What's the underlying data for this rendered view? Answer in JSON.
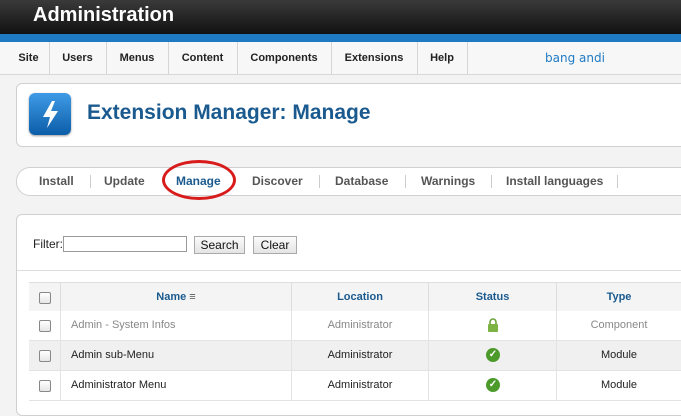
{
  "app": {
    "title": "Administration"
  },
  "menu": {
    "items": [
      "Site",
      "Users",
      "Menus",
      "Content",
      "Components",
      "Extensions",
      "Help"
    ],
    "user": "bang andi"
  },
  "header": {
    "title": "Extension Manager: Manage",
    "icon": "lightning-icon"
  },
  "subnav": {
    "items": [
      "Install",
      "Update",
      "Manage",
      "Discover",
      "Database",
      "Warnings",
      "Install languages"
    ],
    "active": "Manage"
  },
  "filter": {
    "label": "Filter:",
    "value": "",
    "search_label": "Search",
    "clear_label": "Clear"
  },
  "table": {
    "columns": [
      "Name",
      "Location",
      "Status",
      "Type"
    ],
    "rows": [
      {
        "name": "Admin - System Infos",
        "location": "Administrator",
        "status": "protected",
        "type": "Component"
      },
      {
        "name": "Admin sub-Menu",
        "location": "Administrator",
        "status": "enabled",
        "type": "Module"
      },
      {
        "name": "Administrator Menu",
        "location": "Administrator",
        "status": "enabled",
        "type": "Module"
      }
    ]
  },
  "colors": {
    "accent": "#1f7ac4",
    "title": "#1b5a8f",
    "highlight_circle": "#d81b1b",
    "enabled": "#4c9a2a",
    "protected": "#7cb342"
  }
}
